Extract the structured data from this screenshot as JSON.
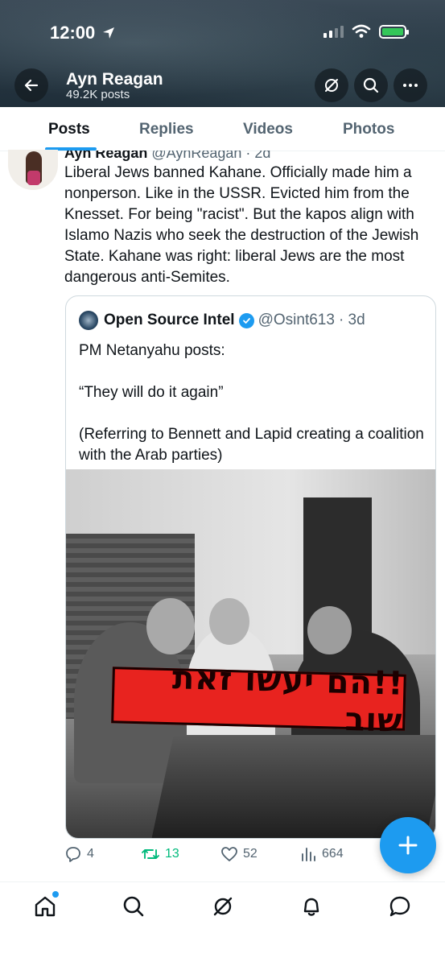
{
  "status_bar": {
    "time": "12:00"
  },
  "header": {
    "back_icon": "arrow-left-icon",
    "profile_name": "Ayn Reagan",
    "post_count": "49.2K posts",
    "grok_icon": "grok-icon",
    "search_icon": "search-icon",
    "more_icon": "more-icon"
  },
  "tabs": [
    {
      "label": "Posts",
      "active": true
    },
    {
      "label": "Replies",
      "active": false
    },
    {
      "label": "Videos",
      "active": false
    },
    {
      "label": "Photos",
      "active": false
    }
  ],
  "tweet": {
    "author_name": "Ayn Reagan",
    "author_handle": "@AynReagan",
    "time": "· 2d",
    "text": "Liberal Jews banned Kahane. Officially made him a nonperson. Like in the USSR. Evicted him from the Knesset. For being \"racist\". But the kapos align with Islamo Nazis who seek the destruction of the Jewish State. Kahane was right: liberal Jews are the most dangerous anti-Semites.",
    "quote": {
      "author_name": "Open Source Intel",
      "author_handle": "@Osint613",
      "time": "· 3d",
      "paragraphs": [
        "PM Netanyahu posts:",
        "“They will do it again”",
        "(Referring to Bennett and Lapid creating a coalition with the Arab parties)"
      ],
      "image_banner_text": "!!הם יעשו זאת שוב"
    },
    "stats": {
      "replies": "4",
      "reposts": "13",
      "likes": "52",
      "views": "664"
    }
  },
  "colors": {
    "accent": "#1d9bf0",
    "repost": "#00ba7c",
    "secondary_text": "#536471",
    "primary_text": "#0f1419"
  },
  "bottom_nav": [
    "home-icon",
    "search-icon",
    "grok-icon",
    "notifications-icon",
    "messages-icon"
  ]
}
